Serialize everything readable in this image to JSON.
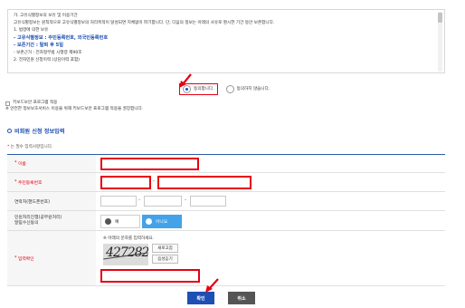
{
  "terms": {
    "lines": [
      "가. 고유식별정보의 보유 및 이용기간",
      "고유식별정보는 원칙적으로 고유식별정보의 처리목적이 달성되면 지체없이 파기합니다. 단, 다음의 정보는 아래의 사유로 명시한 기간 동안 보존합니다.",
      "1. 법령에 의한 보유",
      "- 고유식별정보 : 주민등록번호, 외국인등록번호",
      "- 보존기간 : 탈퇴 후 5일",
      "- 보존근거 : 전자정부법 시행령 제90조",
      "2. 전자민원 신청이력 (상담이력 포함)"
    ]
  },
  "consent": {
    "agree_label": "동의합니다.",
    "disagree_label": "동의하지 않습니다."
  },
  "kb": {
    "label": "키보드보안 프로그램 적용",
    "note": "※ 안전한 정보보호서비스 이용을 위해 키보드보안 프로그램 적용을 권장합니다."
  },
  "section": {
    "title": "비회원 신청 정보입력",
    "required_note": "는 필수 입력사항입니다."
  },
  "form": {
    "name_label": "이름",
    "rrn_label": "주민등록번호",
    "phone_label": "연락처(핸드폰번호)",
    "sms_label": "민원처리진행(공무원처리)\n알림수신동의",
    "sms_yes": "예",
    "sms_no": "아니요",
    "captcha_label": "입력확인",
    "captcha_hint": "※ 아래의 문자를 입력하세요.",
    "captcha_text": "427282",
    "captcha_refresh": "새로고침",
    "captcha_audio": "음성듣기"
  },
  "buttons": {
    "confirm": "확인",
    "cancel": "취소"
  },
  "colors": {
    "accent": "#1d4fb5",
    "highlight": "#e60012",
    "toggle_on": "#44a2e8"
  }
}
